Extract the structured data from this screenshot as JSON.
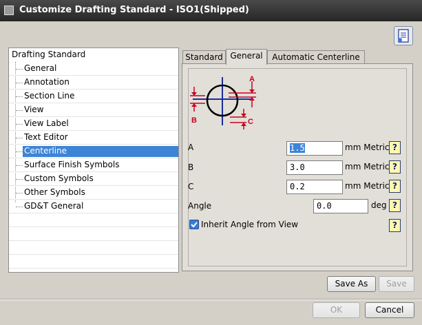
{
  "window": {
    "title": "Customize Drafting Standard - ISO1(Shipped)"
  },
  "tree": {
    "root": "Drafting Standard",
    "items": [
      {
        "label": "General",
        "selected": false
      },
      {
        "label": "Annotation",
        "selected": false
      },
      {
        "label": "Section Line",
        "selected": false
      },
      {
        "label": "View",
        "selected": false
      },
      {
        "label": "View Label",
        "selected": false
      },
      {
        "label": "Text Editor",
        "selected": false
      },
      {
        "label": "Centerline",
        "selected": true
      },
      {
        "label": "Surface Finish Symbols",
        "selected": false
      },
      {
        "label": "Custom Symbols",
        "selected": false
      },
      {
        "label": "Other Symbols",
        "selected": false
      },
      {
        "label": "GD&T General",
        "selected": false
      }
    ]
  },
  "tabs": [
    {
      "label": "Standard",
      "active": false
    },
    {
      "label": "General",
      "active": true
    },
    {
      "label": "Automatic Centerline",
      "active": false
    }
  ],
  "diagram": {
    "label_a": "A",
    "label_b": "B",
    "label_c": "C"
  },
  "fields": {
    "a": {
      "label": "A",
      "value": "1.5",
      "unit": "mm",
      "unit_type": "Metric"
    },
    "b": {
      "label": "B",
      "value": "3.0",
      "unit": "mm",
      "unit_type": "Metric"
    },
    "c": {
      "label": "C",
      "value": "0.2",
      "unit": "mm",
      "unit_type": "Metric"
    },
    "angle": {
      "label": "Angle",
      "value": "0.0",
      "unit": "deg"
    }
  },
  "inherit": {
    "label": "Inherit Angle from View",
    "checked": true
  },
  "help_glyph": "?",
  "buttons": {
    "save_as": "Save As",
    "save": "Save",
    "ok": "OK",
    "cancel": "Cancel"
  },
  "colors": {
    "selection": "#3d84d6",
    "diagram_red": "#c8001e",
    "diagram_blue": "#1b2b9a",
    "help_bg": "#fff9b0"
  }
}
